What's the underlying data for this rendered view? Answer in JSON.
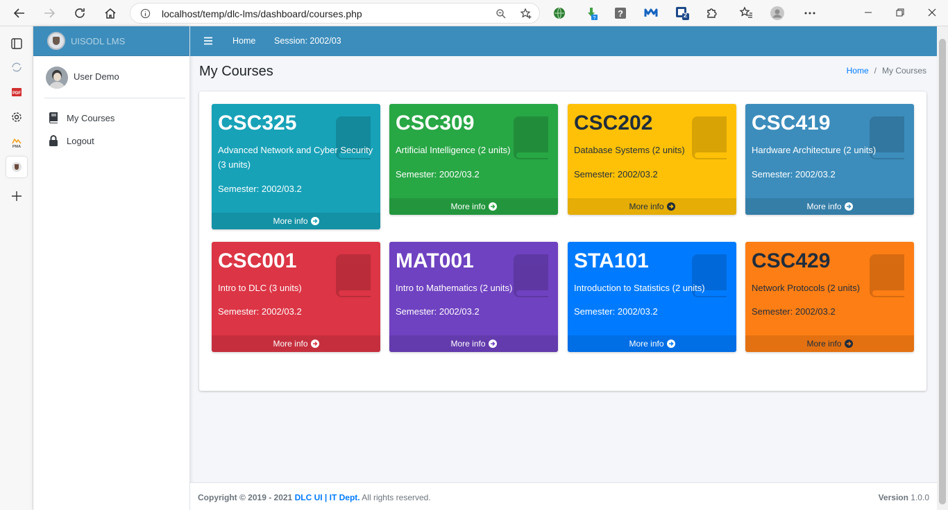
{
  "browser": {
    "url": "localhost/temp/dlc-lms/dashboard/courses.php",
    "ext_badge_count": "2"
  },
  "sidebar": {
    "brand": "UISODL LMS",
    "user_name": "User Demo",
    "menu": [
      {
        "label": "My Courses",
        "icon": "book-icon"
      },
      {
        "label": "Logout",
        "icon": "lock-icon"
      }
    ]
  },
  "topnav": {
    "home": "Home",
    "session": "Session: 2002/03"
  },
  "page": {
    "title": "My Courses",
    "breadcrumb": [
      "Home",
      "/",
      "My Courses"
    ]
  },
  "courses": [
    {
      "code": "CSC325",
      "title": "Advanced Network and Cyber Security (3 units)",
      "semester": "Semester: 2002/03.2",
      "color": "#17a2b8",
      "more": "More info"
    },
    {
      "code": "CSC309",
      "title": "Artificial Intelligence (2 units)",
      "semester": "Semester: 2002/03.2",
      "color": "#28a745",
      "more": "More info"
    },
    {
      "code": "CSC202",
      "title": "Database Systems (2 units)",
      "semester": "Semester: 2002/03.2",
      "color": "#ffc107",
      "more": "More info"
    },
    {
      "code": "CSC419",
      "title": "Hardware Architecture (2 units)",
      "semester": "Semester: 2002/03.2",
      "color": "#3c8dbc",
      "more": "More info"
    },
    {
      "code": "CSC001",
      "title": "Intro to DLC (3 units)",
      "semester": "Semester: 2002/03.2",
      "color": "#dc3545",
      "more": "More info"
    },
    {
      "code": "MAT001",
      "title": "Intro to Mathematics (2 units)",
      "semester": "Semester: 2002/03.2",
      "color": "#6f42c1",
      "more": "More info"
    },
    {
      "code": "STA101",
      "title": "Introduction to Statistics (2 units)",
      "semester": "Semester: 2002/03.2",
      "color": "#007bff",
      "more": "More info"
    },
    {
      "code": "CSC429",
      "title": "Network Protocols (2 units)",
      "semester": "Semester: 2002/03.2",
      "color": "#fd7e14",
      "more": "More info"
    }
  ],
  "footer": {
    "copyright": "Copyright © 2019 - 2021",
    "link1": "DLC UI",
    "sep": "|",
    "link2": "IT Dept.",
    "rights": "All rights reserved.",
    "version_label": "Version",
    "version": "1.0.0"
  }
}
